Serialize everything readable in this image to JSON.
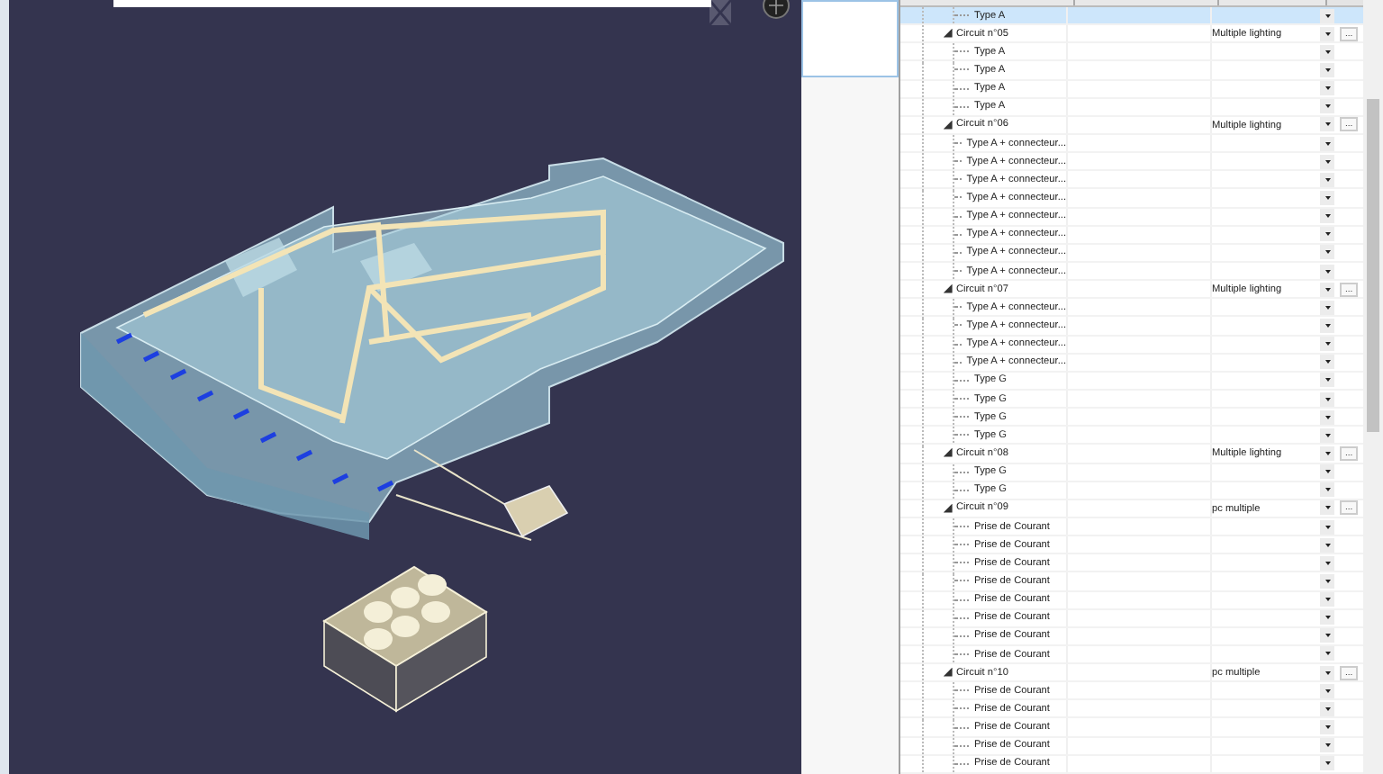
{
  "tree": {
    "items": [
      {
        "kind": "item",
        "label": "Type A",
        "selected": true
      },
      {
        "kind": "circuit",
        "label": "Circuit n°05",
        "value": "Multiple lighting",
        "more": "...",
        "expanded": true,
        "selected": false,
        "children": [
          {
            "kind": "item",
            "label": "Type A",
            "selected": false
          },
          {
            "kind": "item",
            "label": "Type A",
            "selected": false
          },
          {
            "kind": "item",
            "label": "Type A",
            "selected": false
          },
          {
            "kind": "item",
            "label": "Type A",
            "selected": false
          }
        ]
      },
      {
        "kind": "circuit",
        "label": "Circuit n°06",
        "value": "Multiple lighting",
        "more": "...",
        "expanded": true,
        "selected": false,
        "children": [
          {
            "kind": "item",
            "label": "Type A + connecteur...",
            "selected": false
          },
          {
            "kind": "item",
            "label": "Type A + connecteur...",
            "selected": false
          },
          {
            "kind": "item",
            "label": "Type A + connecteur...",
            "selected": false
          },
          {
            "kind": "item",
            "label": "Type A + connecteur...",
            "selected": false
          },
          {
            "kind": "item",
            "label": "Type A + connecteur...",
            "selected": false
          },
          {
            "kind": "item",
            "label": "Type A + connecteur...",
            "selected": false
          },
          {
            "kind": "item",
            "label": "Type A + connecteur...",
            "selected": false
          },
          {
            "kind": "item",
            "label": "Type A + connecteur...",
            "selected": false
          }
        ]
      },
      {
        "kind": "circuit",
        "label": "Circuit n°07",
        "value": "Multiple lighting",
        "more": "...",
        "expanded": true,
        "selected": false,
        "children": [
          {
            "kind": "item",
            "label": "Type A + connecteur...",
            "selected": false
          },
          {
            "kind": "item",
            "label": "Type A + connecteur...",
            "selected": false
          },
          {
            "kind": "item",
            "label": "Type A + connecteur...",
            "selected": false
          },
          {
            "kind": "item",
            "label": "Type A + connecteur...",
            "selected": false
          },
          {
            "kind": "item",
            "label": "Type G",
            "selected": false
          },
          {
            "kind": "item",
            "label": "Type G",
            "selected": false
          },
          {
            "kind": "item",
            "label": "Type G",
            "selected": false
          },
          {
            "kind": "item",
            "label": "Type G",
            "selected": false
          }
        ]
      },
      {
        "kind": "circuit",
        "label": "Circuit n°08",
        "value": "Multiple lighting",
        "more": "...",
        "expanded": true,
        "selected": false,
        "children": [
          {
            "kind": "item",
            "label": "Type G",
            "selected": false
          },
          {
            "kind": "item",
            "label": "Type G",
            "selected": false
          }
        ]
      },
      {
        "kind": "circuit",
        "label": "Circuit n°09",
        "value": "pc multiple",
        "more": "...",
        "expanded": true,
        "selected": false,
        "children": [
          {
            "kind": "item",
            "label": "Prise de Courant",
            "selected": false
          },
          {
            "kind": "item",
            "label": "Prise de Courant",
            "selected": false
          },
          {
            "kind": "item",
            "label": "Prise de Courant",
            "selected": false
          },
          {
            "kind": "item",
            "label": "Prise de Courant",
            "selected": false
          },
          {
            "kind": "item",
            "label": "Prise de Courant",
            "selected": false
          },
          {
            "kind": "item",
            "label": "Prise de Courant",
            "selected": false
          },
          {
            "kind": "item",
            "label": "Prise de Courant",
            "selected": false
          },
          {
            "kind": "item",
            "label": "Prise de Courant",
            "selected": false
          }
        ]
      },
      {
        "kind": "circuit",
        "label": "Circuit n°10",
        "value": "pc multiple",
        "more": "...",
        "expanded": true,
        "selected": false,
        "children": [
          {
            "kind": "item",
            "label": "Prise de Courant",
            "selected": false
          },
          {
            "kind": "item",
            "label": "Prise de Courant",
            "selected": false
          },
          {
            "kind": "item",
            "label": "Prise de Courant",
            "selected": false
          },
          {
            "kind": "item",
            "label": "Prise de Courant",
            "selected": false
          },
          {
            "kind": "item",
            "label": "Prise de Courant",
            "selected": false
          }
        ]
      }
    ]
  }
}
